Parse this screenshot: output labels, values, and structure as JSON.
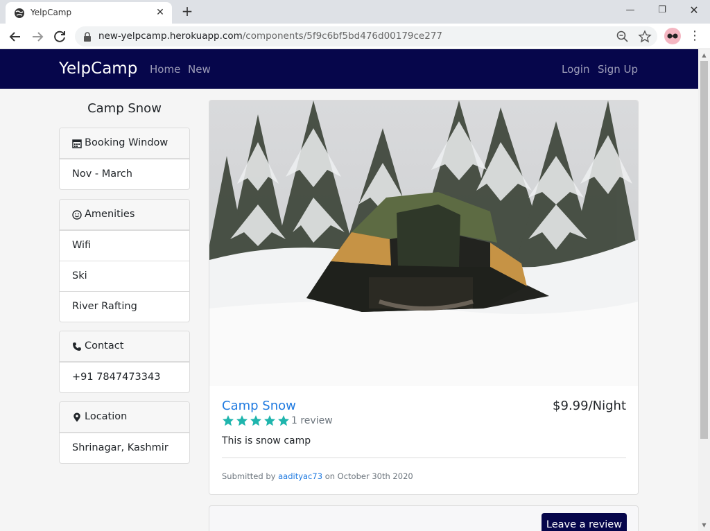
{
  "browser": {
    "tab_title": "YelpCamp",
    "url_host": "new-yelpcamp.herokuapp.com",
    "url_path": "/components/5f9c6bf5bd476d00179ce277"
  },
  "navbar": {
    "brand": "YelpCamp",
    "links": [
      "Home",
      "New"
    ],
    "auth": [
      "Login",
      "Sign Up"
    ]
  },
  "sidebar": {
    "title": "Camp Snow",
    "booking": {
      "header": "Booking Window",
      "icon": "calendar-icon",
      "items": [
        "Nov - March"
      ]
    },
    "amenities": {
      "header": "Amenities",
      "icon": "smile-icon",
      "items": [
        "Wifi",
        "Ski",
        "River Rafting"
      ]
    },
    "contact": {
      "header": "Contact",
      "icon": "phone-icon",
      "items": [
        "+91 7847473343"
      ]
    },
    "location": {
      "header": "Location",
      "icon": "map-marker-icon",
      "items": [
        "Shrinagar, Kashmir"
      ]
    }
  },
  "campground": {
    "name": "Camp Snow",
    "price": "$9.99/Night",
    "rating": 5,
    "reviews_label": "1 review",
    "description": "This is snow camp",
    "submitted_prefix": "Submitted by",
    "author": "aadityac73",
    "submitted_suffix": "on October 30th 2020"
  },
  "reviews": {
    "button": "Leave a review"
  },
  "colors": {
    "navbar": "#06064b",
    "link": "#1f7ae0",
    "star": "#1fb5ad"
  }
}
